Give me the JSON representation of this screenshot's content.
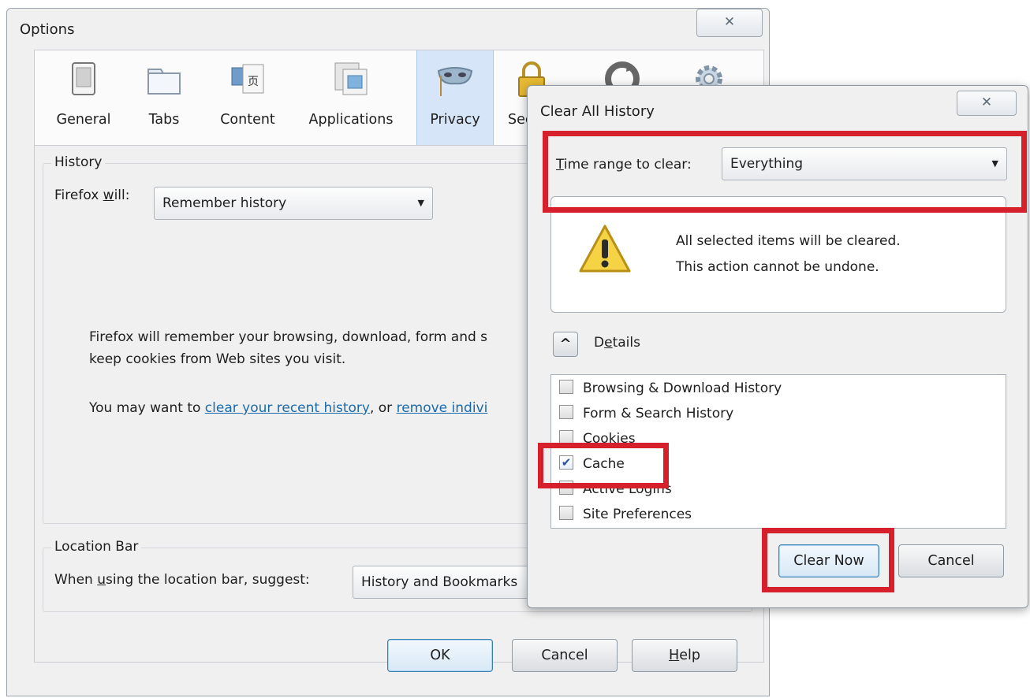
{
  "options_window": {
    "title": "Options",
    "close_glyph": "✕",
    "toolbar": [
      {
        "label": "General",
        "icon": "general-icon",
        "selected": false
      },
      {
        "label": "Tabs",
        "icon": "tabs-icon",
        "selected": false
      },
      {
        "label": "Content",
        "icon": "content-icon",
        "selected": false
      },
      {
        "label": "Applications",
        "icon": "applications-icon",
        "selected": false
      },
      {
        "label": "Privacy",
        "icon": "privacy-mask-icon",
        "selected": true
      },
      {
        "label": "Sec",
        "icon": "security-lock-icon",
        "selected": false
      },
      {
        "label": "",
        "icon": "sync-icon",
        "selected": false
      },
      {
        "label": "",
        "icon": "advanced-gear-icon",
        "selected": false
      }
    ],
    "history": {
      "legend": "History",
      "firefox_will_prefix": "Firefox ",
      "firefox_will_accel": "w",
      "firefox_will_suffix": "ill:",
      "mode_value": "Remember history",
      "description_line1": "Firefox will remember your browsing, download, form and s",
      "description_line2": "keep cookies from Web sites you visit.",
      "may_want_prefix": "You may want to ",
      "link_clear_recent": "clear your recent history",
      "may_want_middle": ", or ",
      "link_remove_individual": "remove indivi"
    },
    "location_bar": {
      "legend": "Location Bar",
      "suggest_prefix": "When ",
      "suggest_accel": "u",
      "suggest_suffix": "sing the location bar, suggest:",
      "suggest_value": "History and Bookmarks"
    },
    "buttons": {
      "ok": "OK",
      "cancel": "Cancel",
      "help_accel": "H",
      "help_rest": "elp"
    }
  },
  "clear_history_dialog": {
    "title": "Clear All History",
    "close_glyph": "✕",
    "time_range_accel": "T",
    "time_range_rest": "ime range to clear:",
    "time_range_value": "Everything",
    "warning_line1": "All selected items will be cleared.",
    "warning_line2": "This action cannot be undone.",
    "details_prefix": "D",
    "details_accel": "e",
    "details_suffix": "tails",
    "details_toggle_glyph": "^",
    "items": [
      {
        "label": "Browsing & Download History",
        "checked": false
      },
      {
        "label": "Form & Search History",
        "checked": false
      },
      {
        "label": "Cookies",
        "checked": false
      },
      {
        "label": "Cache",
        "checked": true
      },
      {
        "label": "Active Logins",
        "checked": false
      },
      {
        "label": "Site Preferences",
        "checked": false
      }
    ],
    "buttons": {
      "clear_now": "Clear Now",
      "cancel": "Cancel"
    }
  },
  "annotation_color": "#d6202c"
}
